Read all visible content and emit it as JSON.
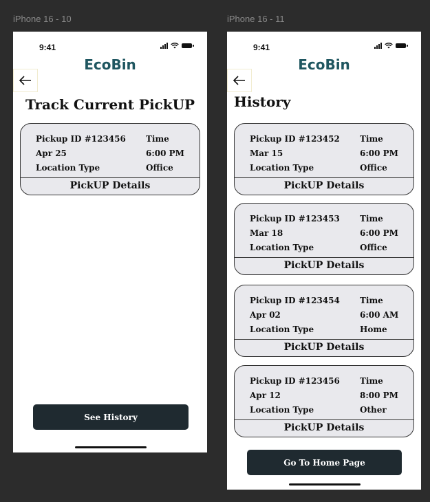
{
  "frames": [
    {
      "label": "iPhone 16 - 10"
    },
    {
      "label": "iPhone 16 - 11"
    }
  ],
  "status_time": "9:41",
  "brand": "EcoBin",
  "screen1": {
    "heading": "Track Current PickUP",
    "card": {
      "pickup_id": "Pickup ID #123456",
      "time_label": "Time",
      "date": "Apr 25",
      "time": "6:00 PM",
      "location_label": "Location Type",
      "location": "Office",
      "details": "PickUP Details"
    },
    "button": "See History"
  },
  "screen2": {
    "heading": "History",
    "cards": [
      {
        "pickup_id": "Pickup ID #123452",
        "time_label": "Time",
        "date": "Mar 15",
        "time": "6:00 PM",
        "location_label": "Location Type",
        "location": "Office",
        "details": "PickUP Details"
      },
      {
        "pickup_id": "Pickup ID #123453",
        "time_label": "Time",
        "date": "Mar 18",
        "time": "6:00 PM",
        "location_label": "Location Type",
        "location": "Office",
        "details": "PickUP Details"
      },
      {
        "pickup_id": "Pickup ID #123454",
        "time_label": "Time",
        "date": "Apr 02",
        "time": "6:00 AM",
        "location_label": "Location Type",
        "location": "Home",
        "details": "PickUP Details"
      },
      {
        "pickup_id": "Pickup ID #123456",
        "time_label": "Time",
        "date": "Apr 12",
        "time": "8:00 PM",
        "location_label": "Location Type",
        "location": "Other",
        "details": "PickUP Details"
      }
    ],
    "button": "Go To Home Page"
  },
  "colors": {
    "brand": "#1f5660",
    "button_bg": "#1f2a30",
    "card_bg": "#e9e9ed",
    "canvas": "#2c2c2c"
  },
  "icons": {
    "back": "arrow-left-icon",
    "signal": "signal-icon",
    "wifi": "wifi-icon",
    "battery": "battery-icon"
  }
}
